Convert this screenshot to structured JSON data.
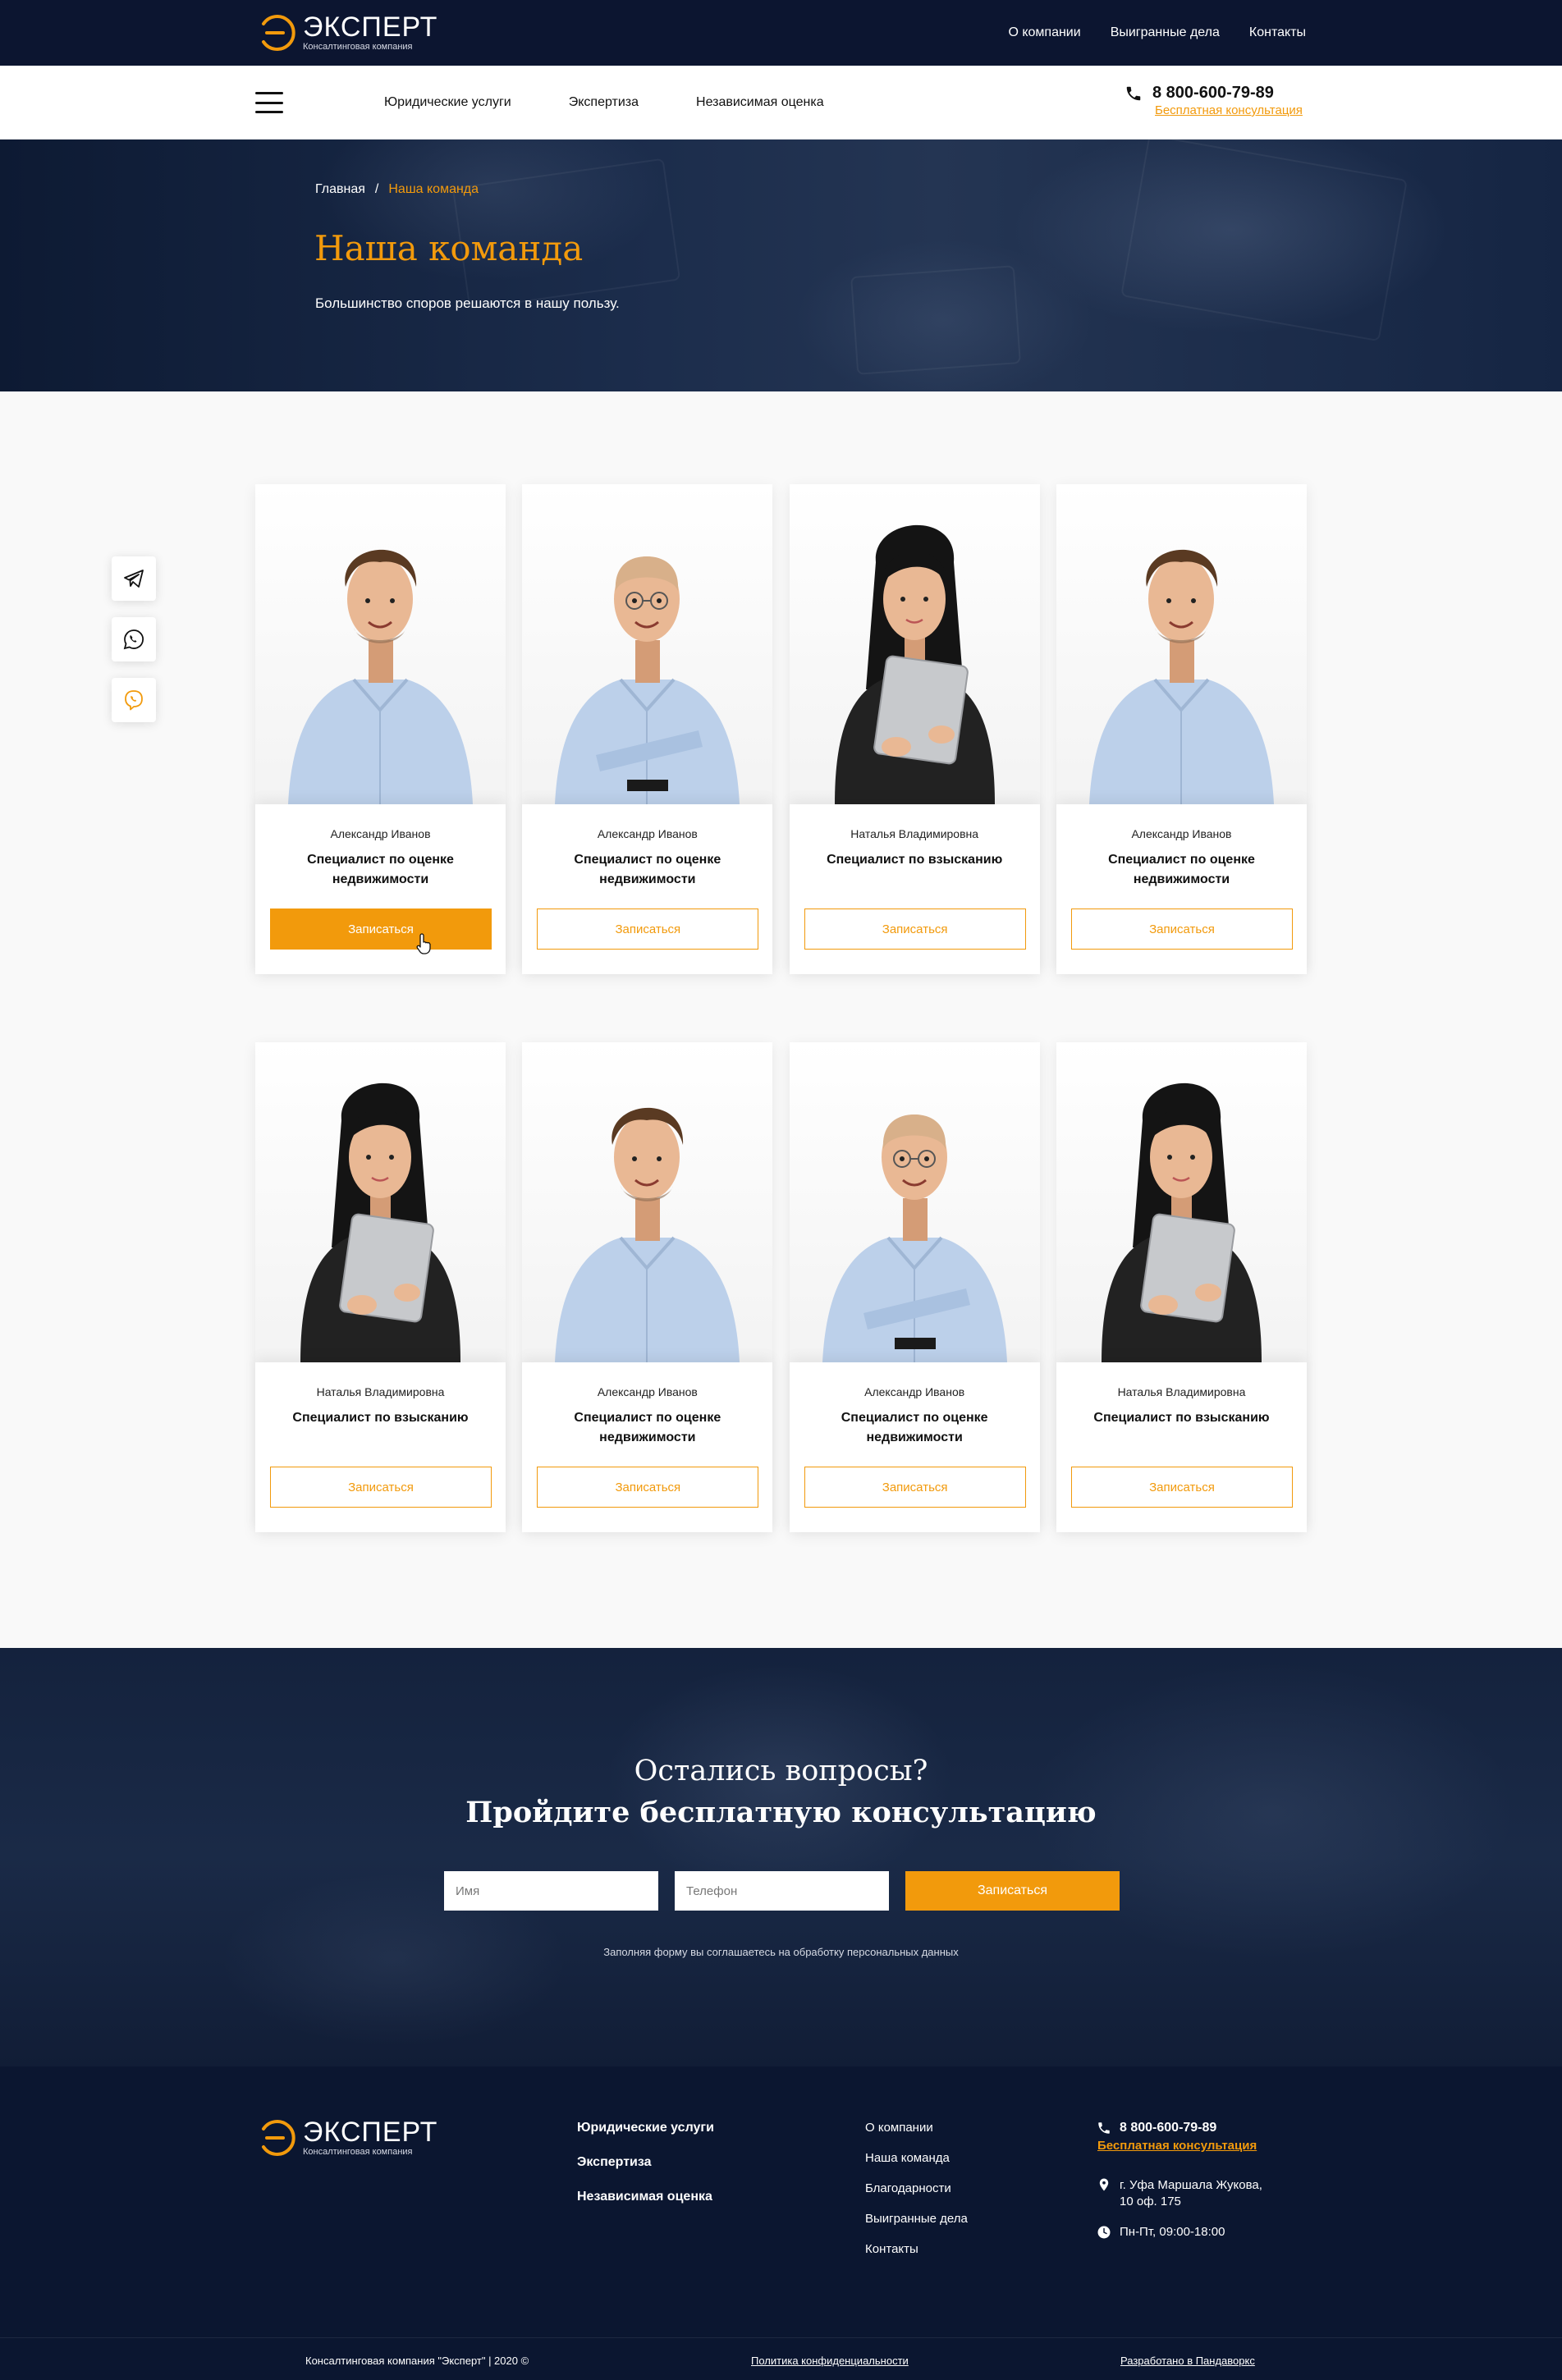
{
  "logo": {
    "brand": "ЭКСПЕРТ",
    "subtitle": "Консалтинговая компания"
  },
  "topnav": [
    "О компании",
    "Выигранные дела",
    "Контакты"
  ],
  "mainnav": [
    "Юридические услуги",
    "Экспертиза",
    "Независимая оценка"
  ],
  "contact": {
    "phone": "8 800-600-79-89",
    "consult": "Бесплатная консультация"
  },
  "breadcrumb": {
    "home": "Главная",
    "separator": "/",
    "current": "Наша команда"
  },
  "hero": {
    "title": "Наша команда",
    "subtitle": "Большинство споров решаются в нашу пользу."
  },
  "social": {
    "icons": [
      "telegram-icon",
      "whatsapp-icon",
      "viber-icon"
    ]
  },
  "team": [
    {
      "name": "Александр Иванов",
      "role": "Специалист по оценке недвижимости",
      "cta": "Записаться",
      "active": true,
      "photo": "man-curly"
    },
    {
      "name": "Александр Иванов",
      "role": "Специалист по оценке недвижимости",
      "cta": "Записаться",
      "active": false,
      "photo": "man-bald"
    },
    {
      "name": "Наталья Владимировна",
      "role": "Специалист по взысканию",
      "cta": "Записаться",
      "active": false,
      "photo": "woman"
    },
    {
      "name": "Александр Иванов",
      "role": "Специалист по оценке недвижимости",
      "cta": "Записаться",
      "active": false,
      "photo": "man-curly"
    },
    {
      "name": "Наталья Владимировна",
      "role": "Специалист по взысканию",
      "cta": "Записаться",
      "active": false,
      "photo": "woman"
    },
    {
      "name": "Александр Иванов",
      "role": "Специалист по оценке недвижимости",
      "cta": "Записаться",
      "active": false,
      "photo": "man-curly"
    },
    {
      "name": "Александр Иванов",
      "role": "Специалист по оценке недвижимости",
      "cta": "Записаться",
      "active": false,
      "photo": "man-bald"
    },
    {
      "name": "Наталья Владимировна",
      "role": "Специалист по взысканию",
      "cta": "Записаться",
      "active": false,
      "photo": "woman"
    }
  ],
  "consultation": {
    "question": "Остались вопросы?",
    "heading": "Пройдите бесплатную консультацию",
    "name_placeholder": "Имя",
    "phone_placeholder": "Телефон",
    "submit": "Записаться",
    "note": "Заполняя форму вы соглашаетесь на обработку персональных данных"
  },
  "footer": {
    "services": [
      "Юридические услуги",
      "Экспертиза",
      "Независимая оценка"
    ],
    "links": [
      "О компании",
      "Наша команда",
      "Благодарности",
      "Выигранные дела",
      "Контакты"
    ],
    "phone": "8 800-600-79-89",
    "consult": "Бесплатная консультация",
    "address_line1": "г. Уфа Маршала Жукова,",
    "address_line2": "10 оф. 175",
    "hours": "Пн-Пт, 09:00-18:00",
    "copyright": "Консалтинговая компания \"Эксперт\" | 2020 ©",
    "privacy": "Политика конфиденциальности",
    "developer": "Разработано в Пандаворкс"
  },
  "colors": {
    "accent": "#f29a0c",
    "navy": "#0c1530",
    "white": "#ffffff"
  }
}
